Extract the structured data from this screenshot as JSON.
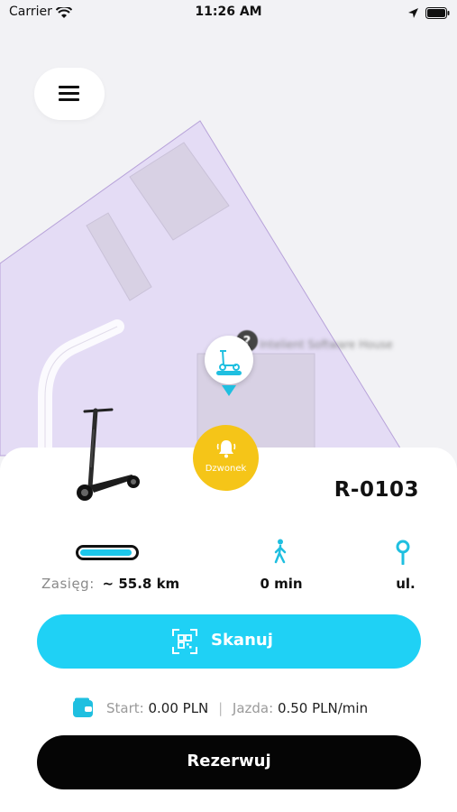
{
  "status_bar": {
    "carrier": "Carrier",
    "time": "11:26 AM",
    "icons": [
      "wifi-icon",
      "location-arrow-icon",
      "battery-icon"
    ]
  },
  "map": {
    "zone_color": "#e4dcf5",
    "zone_border_color": "#b7a2d9",
    "blurred_place_label": "Intelient Software House"
  },
  "menu": {
    "icon": "hamburger-icon"
  },
  "bell": {
    "label": "Dzwonek",
    "color": "#f5c518",
    "icon": "bell-icon"
  },
  "vehicle": {
    "id": "R-0103",
    "battery_level": 0.95,
    "range_label": "Zasięg:",
    "range_value": "~ 55.8 km",
    "walk_time": "0 min",
    "street": "ul."
  },
  "scan_button": {
    "label": "Skanuj",
    "color": "#1fd1f5",
    "icon": "qr-scan-icon"
  },
  "pricing": {
    "start_label": "Start:",
    "start_value": "0.00 PLN",
    "separator": "|",
    "ride_label": "Jazda:",
    "ride_value": "0.50 PLN/min",
    "icon": "wallet-icon"
  },
  "reserve_button": {
    "label": "Rezerwuj",
    "color": "#050505"
  }
}
